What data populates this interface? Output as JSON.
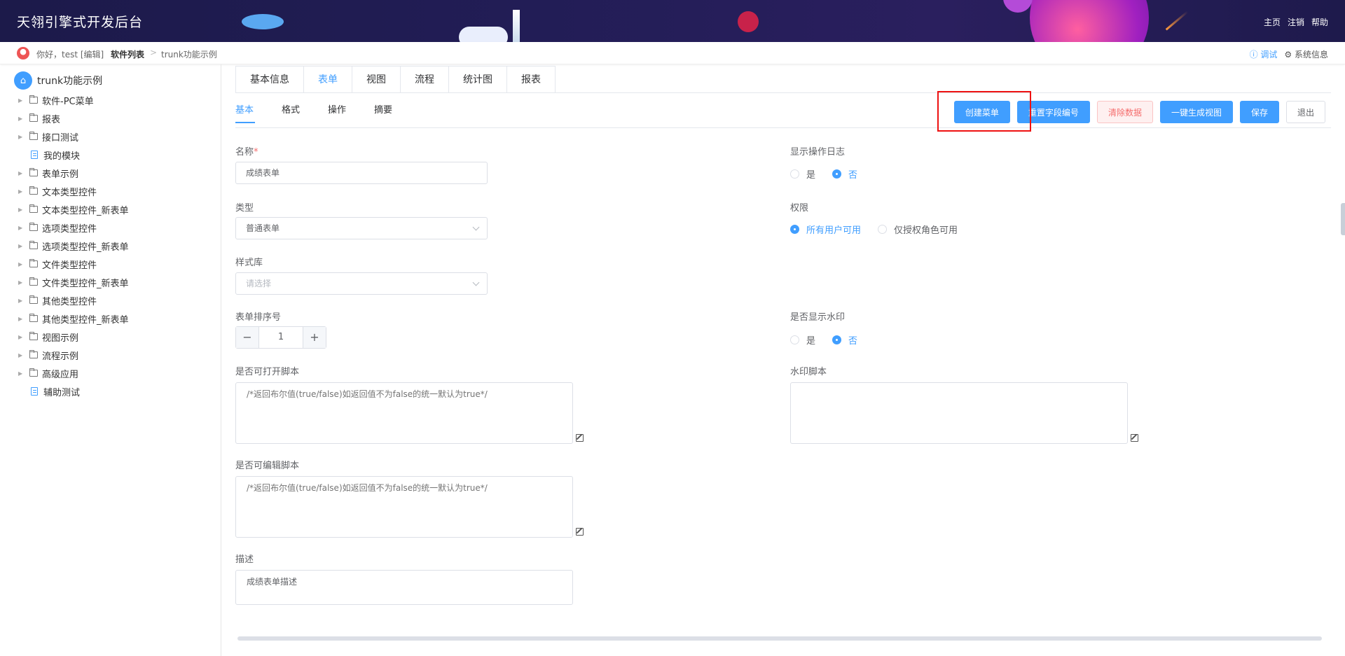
{
  "header": {
    "title": "天翎引擎式开发后台",
    "links": [
      "主页",
      "注销",
      "帮助"
    ]
  },
  "breadcrumb": {
    "greeting": "你好，test [编辑]",
    "software_list": "软件列表",
    "separator": ">",
    "current": "trunk功能示例",
    "debug": "调试",
    "system_info": "系统信息"
  },
  "sidebar": {
    "root": "trunk功能示例",
    "items": [
      {
        "label": "软件-PC菜单",
        "type": "folder"
      },
      {
        "label": "报表",
        "type": "folder"
      },
      {
        "label": "接口测试",
        "type": "folder"
      },
      {
        "label": "我的模块",
        "type": "doc"
      },
      {
        "label": "表单示例",
        "type": "folder"
      },
      {
        "label": "文本类型控件",
        "type": "folder"
      },
      {
        "label": "文本类型控件_新表单",
        "type": "folder"
      },
      {
        "label": "选项类型控件",
        "type": "folder"
      },
      {
        "label": "选项类型控件_新表单",
        "type": "folder"
      },
      {
        "label": "文件类型控件",
        "type": "folder"
      },
      {
        "label": "文件类型控件_新表单",
        "type": "folder"
      },
      {
        "label": "其他类型控件",
        "type": "folder"
      },
      {
        "label": "其他类型控件_新表单",
        "type": "folder"
      },
      {
        "label": "视图示例",
        "type": "folder"
      },
      {
        "label": "流程示例",
        "type": "folder"
      },
      {
        "label": "高级应用",
        "type": "folder"
      },
      {
        "label": "辅助测试",
        "type": "doc"
      }
    ]
  },
  "top_tabs": [
    "基本信息",
    "表单",
    "视图",
    "流程",
    "统计图",
    "报表"
  ],
  "top_tab_active": 1,
  "sub_tabs": [
    "基本",
    "格式",
    "操作",
    "摘要"
  ],
  "actions": {
    "create_menu": "创建菜单",
    "reset_field_no": "重置字段编号",
    "clear_data": "清除数据",
    "generate_view": "一键生成视图",
    "save": "保存",
    "exit": "退出"
  },
  "form": {
    "name_label": "名称",
    "name_required": "*",
    "name_value": "成绩表单",
    "type_label": "类型",
    "type_value": "普通表单",
    "style_label": "样式库",
    "style_placeholder": "请选择",
    "order_label": "表单排序号",
    "order_value": "1",
    "open_script_label": "是否可打开脚本",
    "open_script_placeholder": "/*返回布尔值(true/false)如返回值不为false的统一默认为true*/",
    "edit_script_label": "是否可编辑脚本",
    "edit_script_placeholder": "/*返回布尔值(true/false)如返回值不为false的统一默认为true*/",
    "desc_label": "描述",
    "desc_value": "成绩表单描述",
    "show_log_label": "显示操作日志",
    "show_log_yes": "是",
    "show_log_no": "否",
    "permission_label": "权限",
    "permission_all": "所有用户可用",
    "permission_role": "仅授权角色可用",
    "watermark_label": "是否显示水印",
    "watermark_yes": "是",
    "watermark_no": "否",
    "watermark_script_label": "水印脚本"
  },
  "colors": {
    "primary": "#409eff",
    "header_bg": "#1c1a4a",
    "highlight": "#ee1111"
  }
}
